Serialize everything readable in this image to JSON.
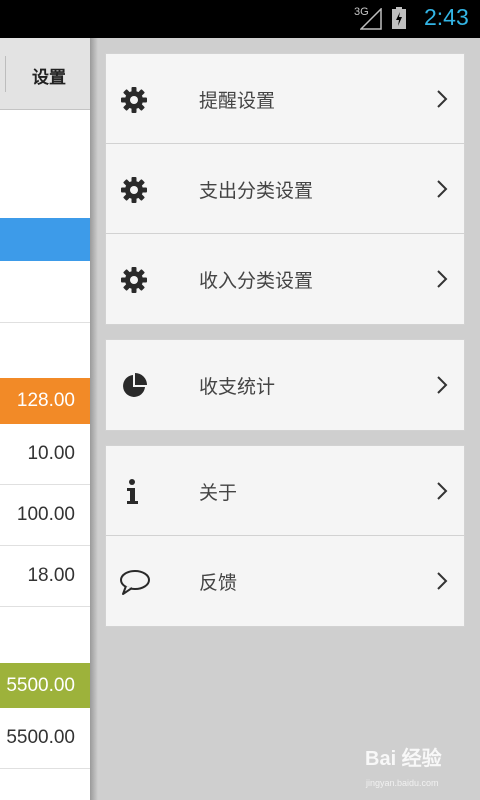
{
  "status_bar": {
    "network": "3G",
    "time": "2:43"
  },
  "left_panel": {
    "settings_label": "设置",
    "values": [
      "128.00",
      "10.00",
      "100.00",
      "18.00",
      "5500.00",
      "5500.00"
    ]
  },
  "menu": {
    "group1": [
      {
        "label": "提醒设置",
        "icon": "gear-icon"
      },
      {
        "label": "支出分类设置",
        "icon": "gear-icon"
      },
      {
        "label": "收入分类设置",
        "icon": "gear-icon"
      }
    ],
    "group2": [
      {
        "label": "收支统计",
        "icon": "pie-chart-icon"
      }
    ],
    "group3": [
      {
        "label": "关于",
        "icon": "info-icon"
      },
      {
        "label": "反馈",
        "icon": "speech-bubble-icon"
      }
    ]
  },
  "watermark": {
    "brand": "Bai 经验",
    "url": "jingyan.baidu.com"
  },
  "colors": {
    "accent_blue": "#3d9be9",
    "orange": "#f28a27",
    "green": "#9db23b",
    "clock": "#33b5e5"
  }
}
